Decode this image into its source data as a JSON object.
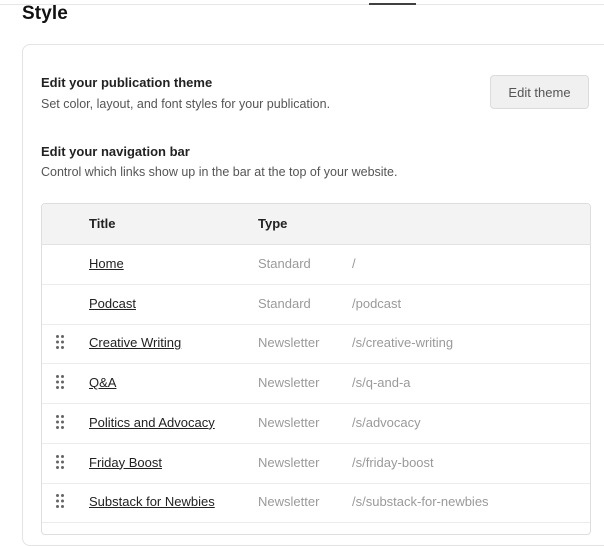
{
  "page": {
    "title": "Style"
  },
  "theme_section": {
    "title": "Edit your publication theme",
    "description": "Set color, layout, and font styles for your publication.",
    "button_label": "Edit theme"
  },
  "nav_section": {
    "title": "Edit your navigation bar",
    "description": "Control which links show up in the bar at the top of your website."
  },
  "nav_table": {
    "columns": {
      "title": "Title",
      "type": "Type"
    },
    "rows": [
      {
        "title": "Home",
        "type": "Standard",
        "url": "/",
        "draggable": false
      },
      {
        "title": "Podcast",
        "type": "Standard",
        "url": "/podcast",
        "draggable": false
      },
      {
        "title": "Creative Writing",
        "type": "Newsletter",
        "url": "/s/creative-writing",
        "draggable": true
      },
      {
        "title": "Q&A",
        "type": "Newsletter",
        "url": "/s/q-and-a",
        "draggable": true
      },
      {
        "title": "Politics and Advocacy",
        "type": "Newsletter",
        "url": "/s/advocacy",
        "draggable": true
      },
      {
        "title": "Friday Boost",
        "type": "Newsletter",
        "url": "/s/friday-boost",
        "draggable": true
      },
      {
        "title": "Substack for Newbies",
        "type": "Newsletter",
        "url": "/s/substack-for-newbies",
        "draggable": true
      }
    ]
  },
  "icons": {
    "drag_handle": "drag-handle-icon"
  }
}
